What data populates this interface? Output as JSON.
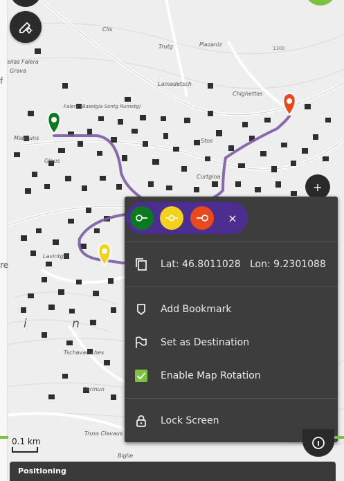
{
  "map": {
    "labels": {
      "clis": "Clis",
      "trutg": "Trutg",
      "plazaniz": "Plazaniz",
      "teilas_falera": "eilas Falera",
      "grava": "Grava",
      "lamadetsch": "Lamadetsch",
      "chighettas": "Chighettas",
      "falera_church": "Falera (Baselgia Sontg Rumetg)",
      "manduns": "Manduns",
      "glaus": "Glaus",
      "stos": "Stos",
      "curtgina": "Curtgina",
      "lavintgin": "Lavintgin",
      "tschavarsches": "Tschavarsches",
      "parmun": "Parmun",
      "truss_clavaus": "Truss Clavaus",
      "biglie": "Biglie",
      "big_letters": "i n",
      "elev": "1300"
    },
    "scale_label": "0.1 km"
  },
  "left_strip": {
    "top_char": "f",
    "mid_char": "re"
  },
  "colors": {
    "route": "#7b5aa6",
    "pin_green": "#0a7a1e",
    "pin_yellow": "#f2d21a",
    "pin_red": "#e84a1b",
    "accent_green": "#7cc242",
    "panel_bg": "#3d3d3d",
    "dots_bg": "#4b2e8f"
  },
  "context_menu": {
    "point_buttons": [
      {
        "name": "start",
        "color": "#0a7a1e",
        "icon": "start-point-icon"
      },
      {
        "name": "via",
        "color": "#f2d21a",
        "icon": "via-point-icon"
      },
      {
        "name": "end",
        "color": "#e84a1b",
        "icon": "end-point-icon"
      }
    ],
    "close_label": "×",
    "coordinates": "Lat: 46.8011028   Lon: 9.2301088",
    "items": [
      {
        "label": "Add Bookmark",
        "icon": "bookmark-icon"
      },
      {
        "label": "Set as Destination",
        "icon": "flag-icon"
      },
      {
        "label": "Enable Map Rotation",
        "icon": "checkbox-checked-icon",
        "checked": true
      }
    ],
    "lock_label": "Lock Screen"
  },
  "plus_label": "+",
  "bottom_bar": {
    "title": "Positioning"
  }
}
